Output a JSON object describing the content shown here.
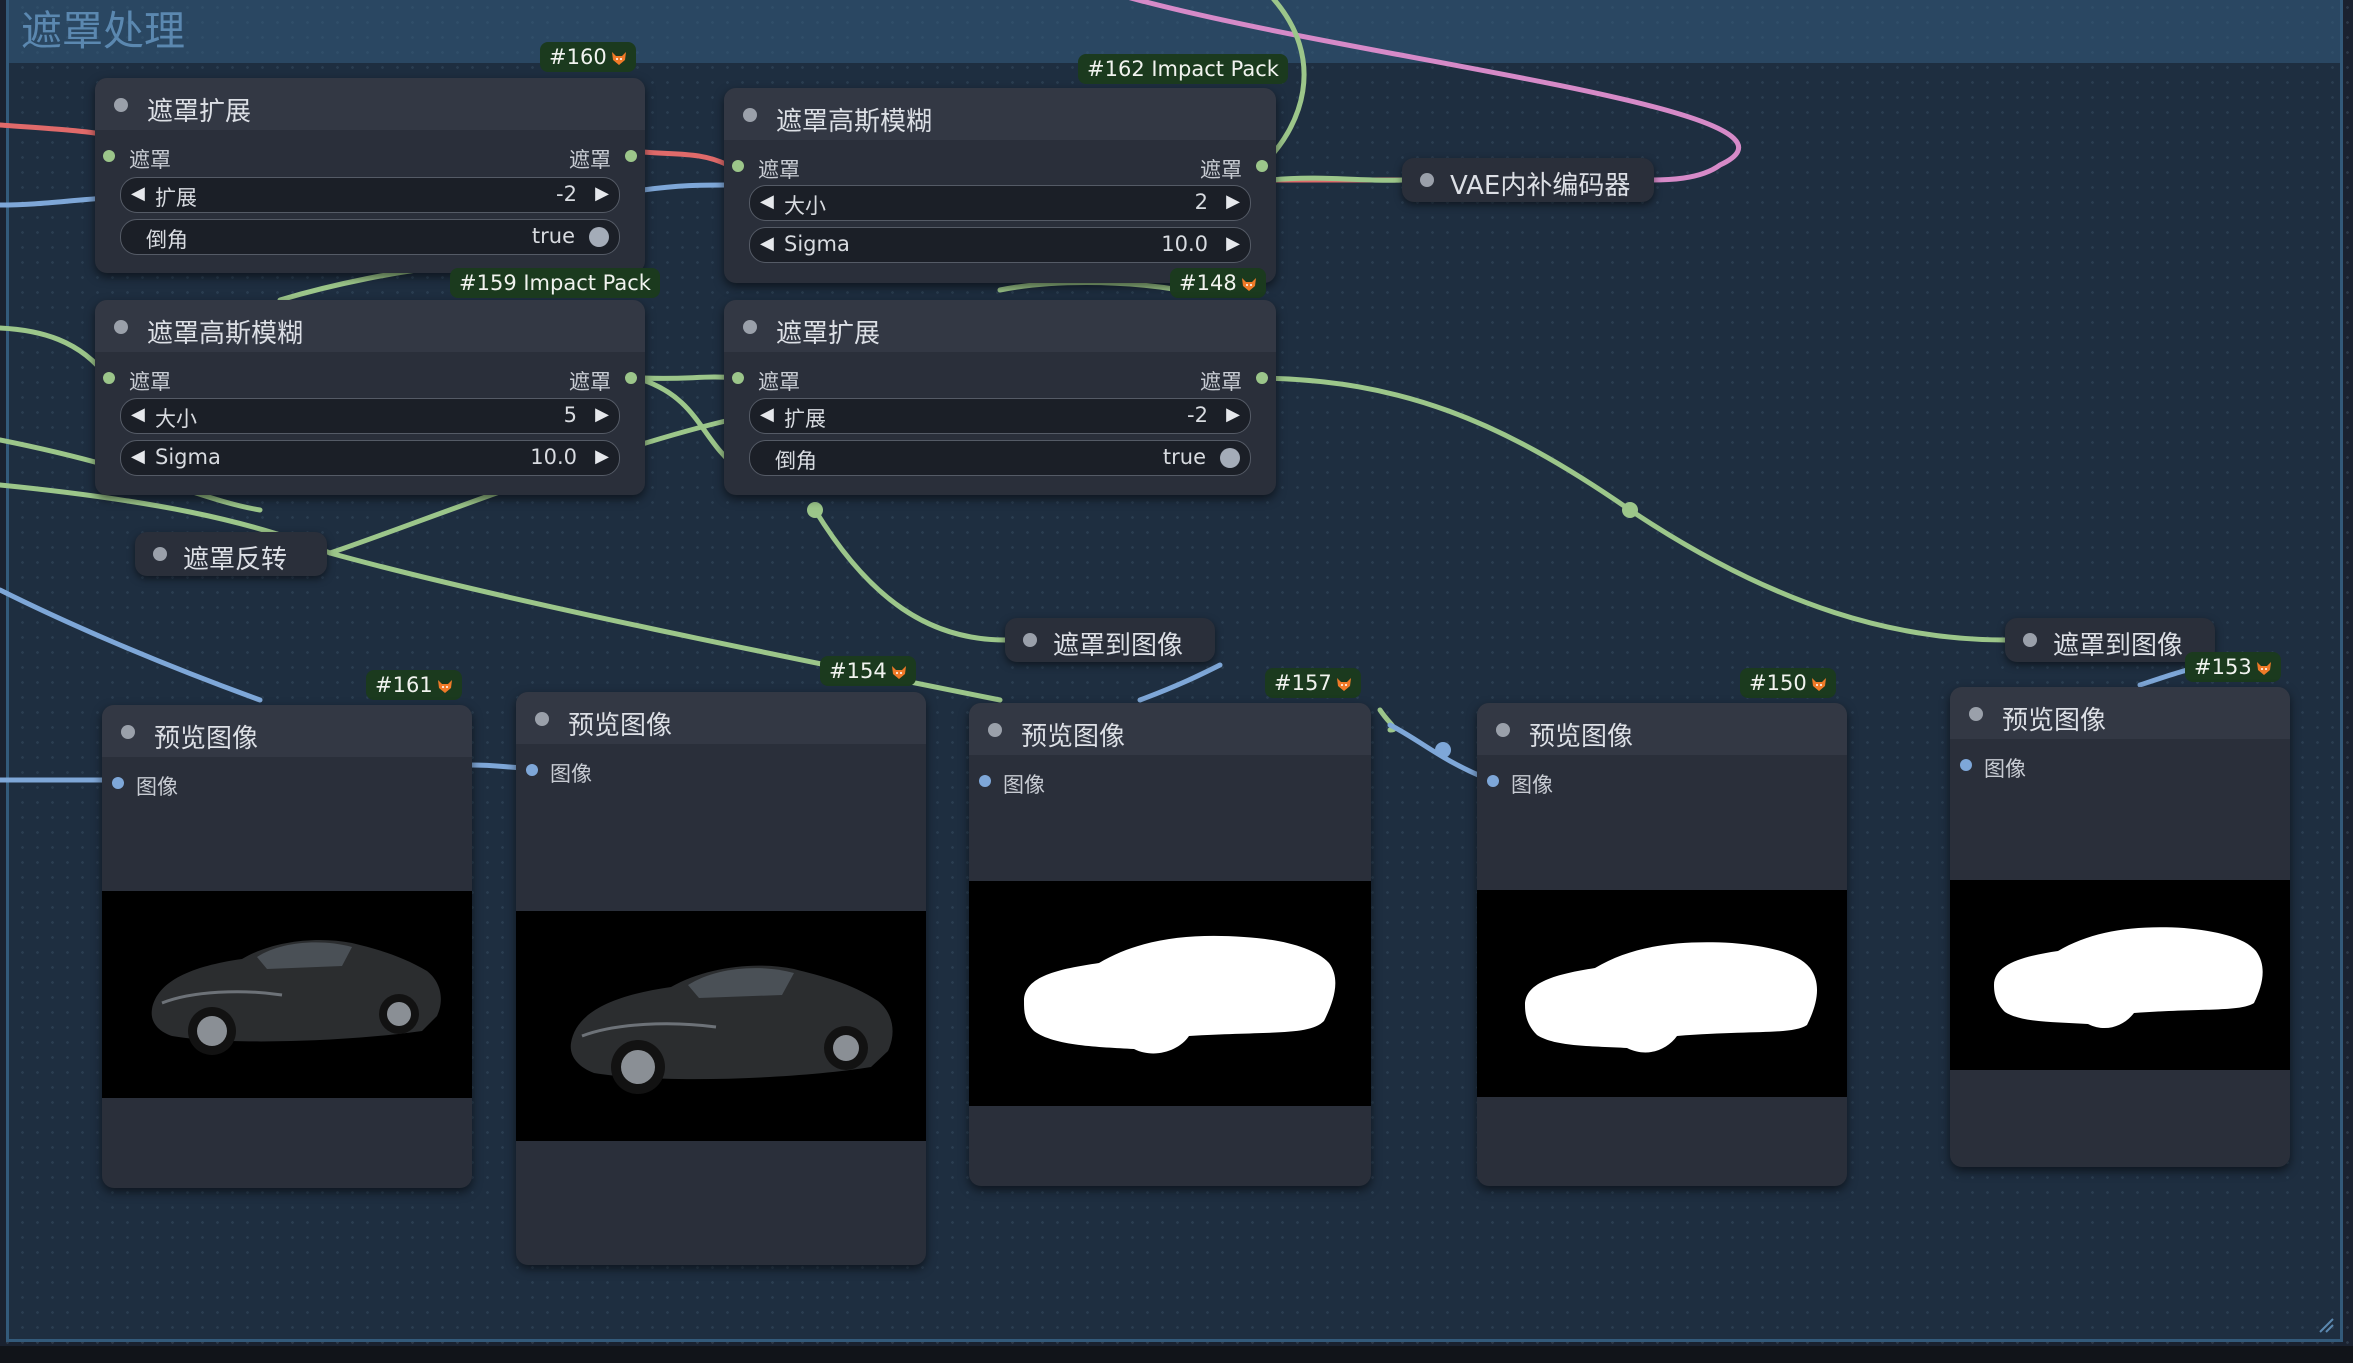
{
  "group": {
    "title": "遮罩处理"
  },
  "colors": {
    "wire_green": "#9cc68a",
    "wire_blue": "#7ea7d8",
    "wire_red": "#e06a6a",
    "wire_pink": "#d68ac8",
    "badge_bg": "#1b3a1e",
    "node_bg": "#2a2f3a"
  },
  "nodes": {
    "n160": {
      "badge": "#160",
      "title": "遮罩扩展",
      "in_label": "遮罩",
      "out_label": "遮罩",
      "w1_label": "扩展",
      "w1_value": "-2",
      "w2_label": "倒角",
      "w2_value": "true"
    },
    "n162": {
      "badge": "#162 Impact Pack",
      "title": "遮罩高斯模糊",
      "in_label": "遮罩",
      "out_label": "遮罩",
      "w1_label": "大小",
      "w1_value": "2",
      "w2_label": "Sigma",
      "w2_value": "10.0"
    },
    "n159": {
      "badge": "#159 Impact Pack",
      "title": "遮罩高斯模糊",
      "in_label": "遮罩",
      "out_label": "遮罩",
      "w1_label": "大小",
      "w1_value": "5",
      "w2_label": "Sigma",
      "w2_value": "10.0"
    },
    "n148": {
      "badge": "#148",
      "title": "遮罩扩展",
      "in_label": "遮罩",
      "out_label": "遮罩",
      "w1_label": "扩展",
      "w1_value": "-2",
      "w2_label": "倒角",
      "w2_value": "true"
    },
    "vae": {
      "title": "VAE内补编码器"
    },
    "invert": {
      "title": "遮罩反转"
    },
    "m2i_a": {
      "title": "遮罩到图像"
    },
    "m2i_b": {
      "title": "遮罩到图像"
    },
    "p161": {
      "badge": "#161",
      "title": "预览图像",
      "in_label": "图像"
    },
    "p154": {
      "badge": "#154",
      "title": "预览图像",
      "in_label": "图像"
    },
    "p157": {
      "badge": "#157",
      "title": "预览图像",
      "in_label": "图像"
    },
    "p150": {
      "badge": "#150",
      "title": "预览图像",
      "in_label": "图像"
    },
    "p153": {
      "badge": "#153",
      "title": "预览图像",
      "in_label": "图像"
    }
  }
}
